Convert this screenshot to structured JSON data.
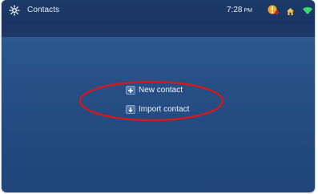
{
  "header": {
    "title": "Contacts",
    "time": "7:28",
    "ampm": "PM"
  },
  "icons": {
    "menu": "settings-icon",
    "alert": "alert-icon",
    "home": "home-icon",
    "wifi": "wifi-icon"
  },
  "actions": {
    "new_contact": "New contact",
    "import_contact": "Import contact"
  },
  "colors": {
    "background": "#264f86",
    "header": "#1b3a68",
    "annotation": "#d11a1a",
    "alert": "#f5a623",
    "home": "#f3c24b",
    "wifi": "#39d86b"
  }
}
